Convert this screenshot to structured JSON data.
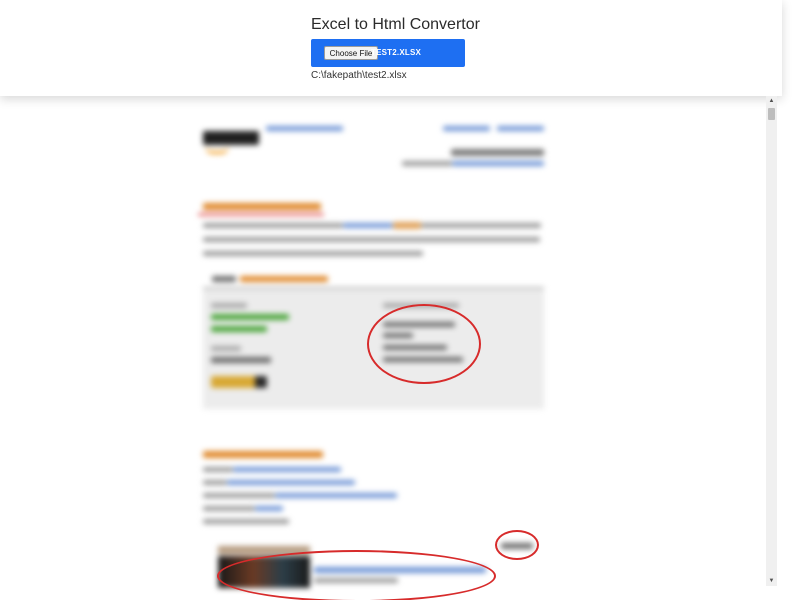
{
  "header": {
    "title": "Excel to Html Convertor",
    "choose_file_label": "Choose File",
    "file_name": "TEST2.XLSX",
    "file_path": "C:\\fakepath\\test2.xlsx"
  },
  "colors": {
    "file_bar": "#1e6ff2",
    "link_blue": "#4c7fc7",
    "heading_orange": "#e08a2e",
    "delivered_green": "#4aa63a",
    "annotation_red": "#d72b2b"
  }
}
